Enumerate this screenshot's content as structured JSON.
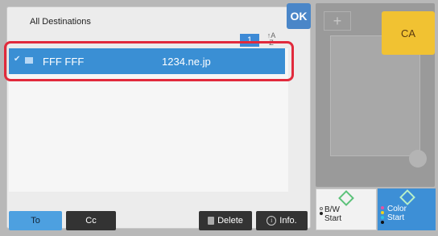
{
  "dialog": {
    "title": "All Destinations",
    "ok_label": "OK",
    "page_number": "1",
    "sort_icon": "sort-a-z-icon"
  },
  "destination_list": [
    {
      "name": "FFF FFF",
      "address": "1234.ne.jp",
      "selected": true
    }
  ],
  "bottom_bar": {
    "to_label": "To",
    "cc_label": "Cc",
    "delete_label": "Delete",
    "info_label": "Info."
  },
  "side": {
    "ca_label": "CA",
    "bw_start_top": "B/W",
    "bw_start_bottom": "Start",
    "color_start_top": "Color",
    "color_start_bottom": "Start"
  },
  "colors": {
    "accent_blue": "#3a8fd4",
    "highlight_red": "#e12a3c",
    "ca_yellow": "#f1c232"
  }
}
